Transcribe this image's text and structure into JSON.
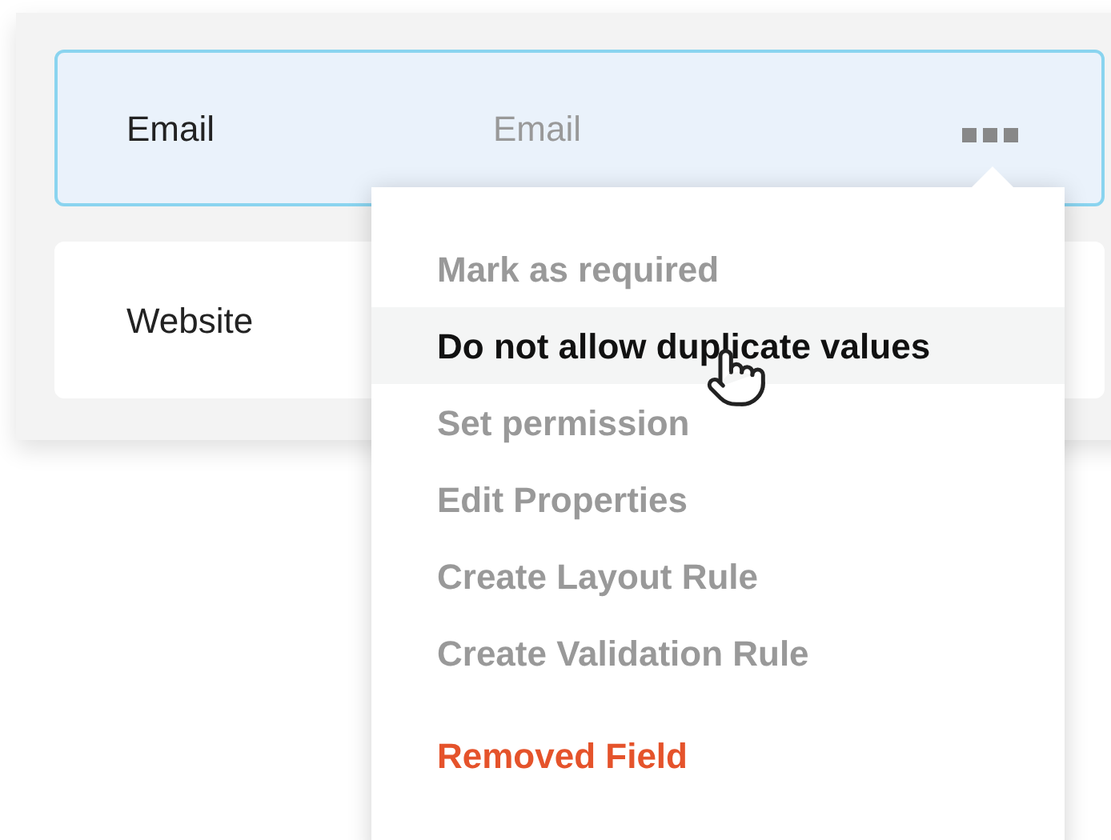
{
  "fields": [
    {
      "label": "Email",
      "placeholder": "Email",
      "selected": true
    },
    {
      "label": "Website",
      "selected": false
    }
  ],
  "menu": {
    "items": [
      {
        "label": "Mark as required",
        "kind": "normal",
        "highlighted": false
      },
      {
        "label": "Do not allow duplicate values",
        "kind": "normal",
        "highlighted": true
      },
      {
        "label": "Set permission",
        "kind": "normal",
        "highlighted": false
      },
      {
        "label": "Edit Properties",
        "kind": "normal",
        "highlighted": false
      },
      {
        "label": "Create Layout Rule",
        "kind": "normal",
        "highlighted": false
      },
      {
        "label": "Create Validation Rule",
        "kind": "normal",
        "highlighted": false
      },
      {
        "label": "Removed Field",
        "kind": "danger",
        "highlighted": false
      }
    ]
  }
}
